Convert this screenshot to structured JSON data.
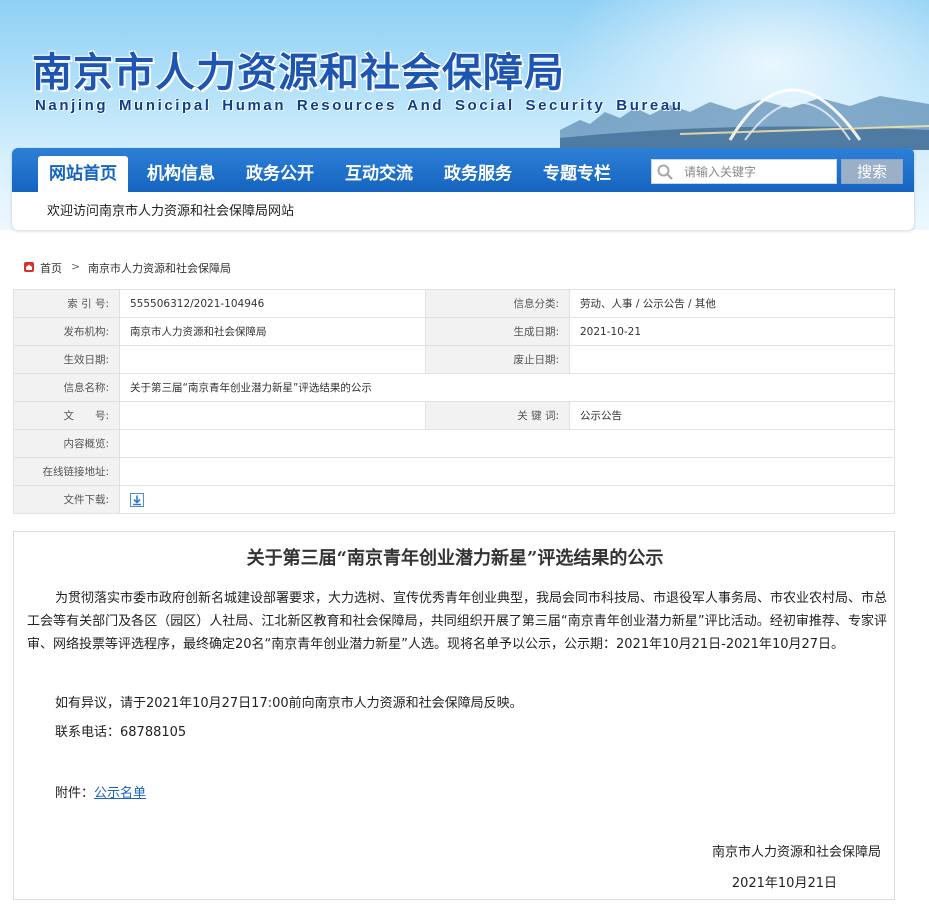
{
  "banner": {
    "title_cn": "南京市人力资源和社会保障局",
    "title_en": "Nanjing Municipal Human Resources And Social Security Bureau"
  },
  "nav": {
    "items": [
      {
        "label": "网站首页",
        "active": true
      },
      {
        "label": "机构信息",
        "active": false
      },
      {
        "label": "政务公开",
        "active": false
      },
      {
        "label": "互动交流",
        "active": false
      },
      {
        "label": "政务服务",
        "active": false
      },
      {
        "label": "专题专栏",
        "active": false
      }
    ],
    "search_placeholder": "请输入关键字",
    "search_button": "搜索",
    "welcome": "欢迎访问南京市人力资源和社会保障局网站"
  },
  "breadcrumb": {
    "home": "首页",
    "separator": ">",
    "current": "南京市人力资源和社会保障局"
  },
  "meta": {
    "index_label": "索 引 号:",
    "index_value": "555506312/2021-104946",
    "category_label": "信息分类:",
    "category_value": "劳动、人事 / 公示公告 / 其他",
    "publisher_label": "发布机构:",
    "publisher_value": "南京市人力资源和社会保障局",
    "created_label": "生成日期:",
    "created_value": "2021-10-21",
    "effective_label": "生效日期:",
    "effective_value": "",
    "expire_label": "废止日期:",
    "expire_value": "",
    "name_label": "信息名称:",
    "name_value": "关于第三届“南京青年创业潜力新星”评选结果的公示",
    "docno_label": "文　　号:",
    "docno_value": "",
    "keywords_label": "关 键 词:",
    "keywords_value": "公示公告",
    "summary_label": "内容概览:",
    "summary_value": "",
    "link_label": "在线链接地址:",
    "link_value": "",
    "download_label": "文件下载:"
  },
  "article": {
    "title": "关于第三届“南京青年创业潜力新星”评选结果的公示",
    "para1": "为贯彻落实市委市政府创新名城建设部署要求，大力选树、宣传优秀青年创业典型，我局会同市科技局、市退役军人事务局、市农业农村局、市总工会等有关部门及各区（园区）人社局、江北新区教育和社会保障局，共同组织开展了第三届“南京青年创业潜力新星”评比活动。经初审推荐、专家评审、网络投票等评选程序，最终确定20名“南京青年创业潜力新星”人选。现将名单予以公示，公示期：2021年10月21日-2021年10月27日。",
    "para2": "如有异议，请于2021年10月27日17:00前向南京市人力资源和社会保障局反映。",
    "para3": "联系电话：68788105",
    "attach_label": "附件：",
    "attach_link": "公示名单",
    "sign_org": "南京市人力资源和社会保障局",
    "sign_date": "2021年10月21日"
  }
}
